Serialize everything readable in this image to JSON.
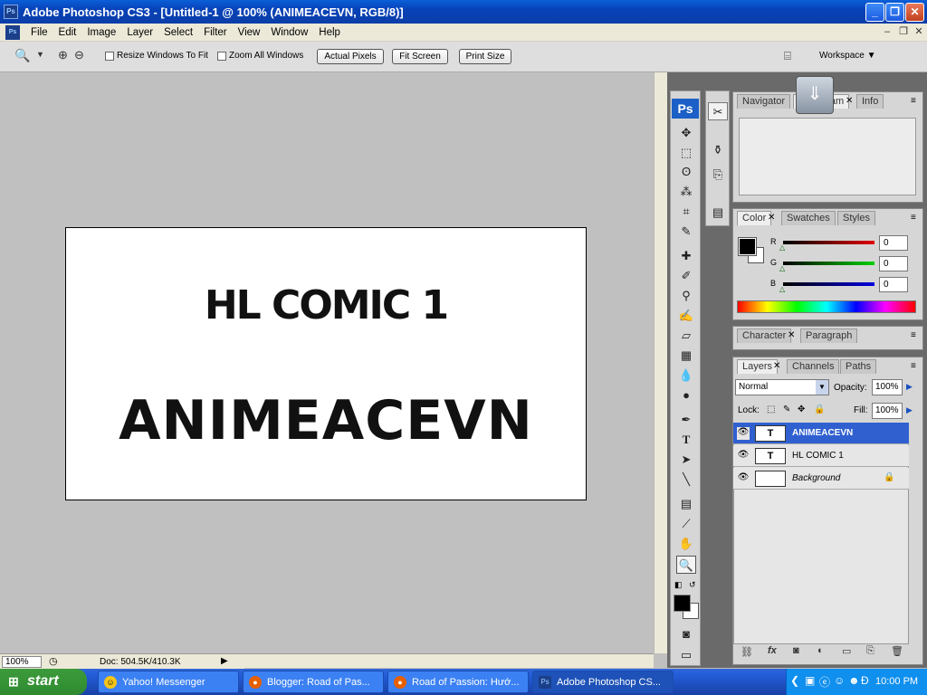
{
  "window": {
    "title": "Adobe Photoshop CS3 - [Untitled-1 @ 100% (ANIMEACEVN, RGB/8)]",
    "app_icon": "Ps"
  },
  "menu": [
    "File",
    "Edit",
    "Image",
    "Layer",
    "Select",
    "Filter",
    "View",
    "Window",
    "Help"
  ],
  "options": {
    "resize_windows": "Resize Windows To Fit",
    "zoom_all": "Zoom All Windows",
    "actual_pixels": "Actual Pixels",
    "fit_screen": "Fit Screen",
    "print_size": "Print Size",
    "workspace": "Workspace ▼"
  },
  "document": {
    "line1": "HL COMIC 1",
    "line2": "ANIMEACEVN"
  },
  "status": {
    "zoom": "100%",
    "doc": "Doc: 504.5K/410.3K"
  },
  "toolbox": {
    "logo": "Ps"
  },
  "panels": {
    "navigator_tabs": [
      "Navigator",
      "Histogram",
      "Info"
    ],
    "color_tabs": [
      "Color",
      "Swatches",
      "Styles"
    ],
    "character_tabs": [
      "Character",
      "Paragraph"
    ],
    "layers_tabs": [
      "Layers",
      "Channels",
      "Paths"
    ]
  },
  "color": {
    "r_label": "R",
    "g_label": "G",
    "b_label": "B",
    "r": "0",
    "g": "0",
    "b": "0"
  },
  "layers": {
    "blend_mode": "Normal",
    "opacity_label": "Opacity:",
    "opacity": "100%",
    "lock_label": "Lock:",
    "fill_label": "Fill:",
    "fill": "100%",
    "items": [
      {
        "name": "ANIMEACEVN",
        "thumb": "T",
        "selected": true
      },
      {
        "name": "HL COMIC 1",
        "thumb": "T",
        "selected": false
      },
      {
        "name": "Background",
        "thumb": "",
        "selected": false
      }
    ]
  },
  "taskbar": {
    "start": "start",
    "tasks": [
      "Yahoo! Messenger",
      "Blogger: Road of Pas...",
      "Road of Passion: Hướ...",
      "Adobe Photoshop CS..."
    ],
    "clock": "10:00 PM"
  },
  "colors": {
    "titlebar": "#0842b8",
    "selected_layer": "#3060d0",
    "taskbar": "#245edb",
    "start_green": "#2f8a2f"
  }
}
